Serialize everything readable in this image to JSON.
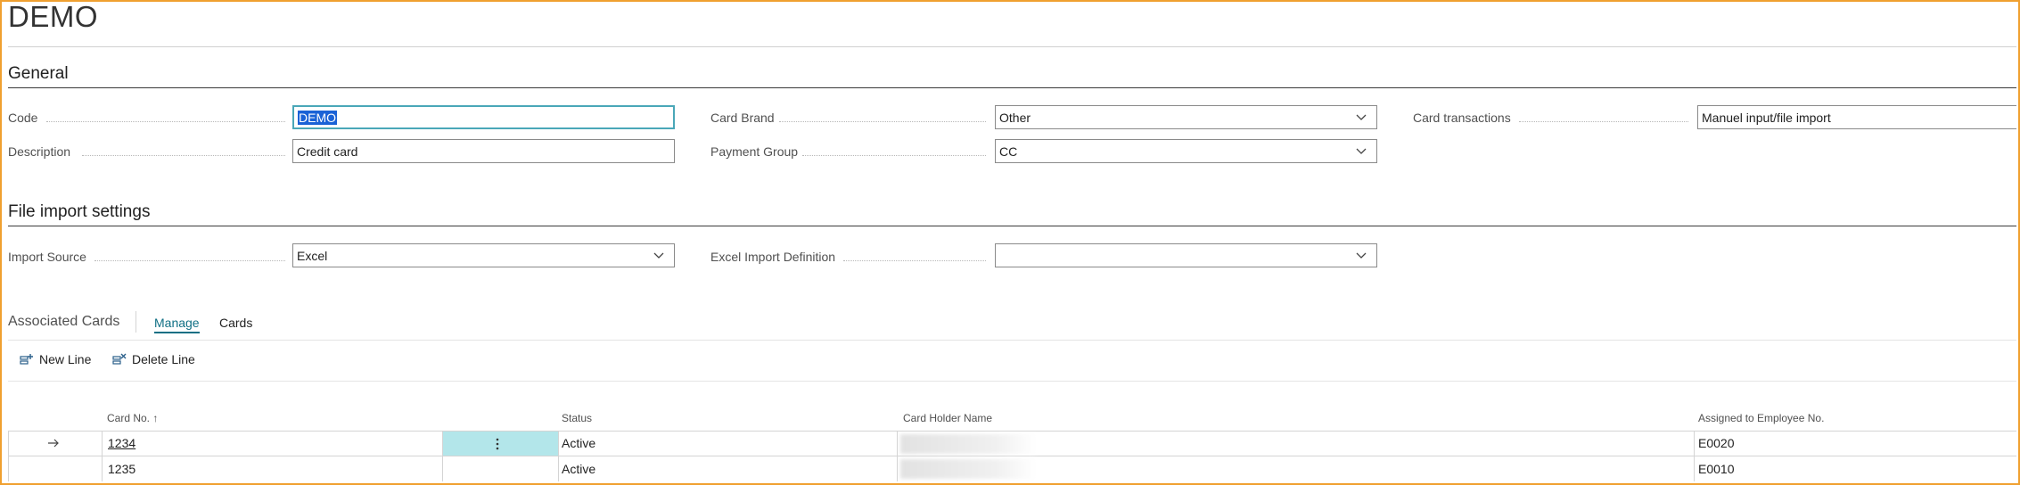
{
  "page": {
    "title": "DEMO"
  },
  "general": {
    "heading": "General",
    "code_label": "Code",
    "code_value": "DEMO",
    "description_label": "Description",
    "description_value": "Credit card",
    "card_brand_label": "Card Brand",
    "card_brand_value": "Other",
    "payment_group_label": "Payment Group",
    "payment_group_value": "CC",
    "card_transactions_label": "Card transactions",
    "card_transactions_value": "Manuel input/file import"
  },
  "file_import": {
    "heading": "File import settings",
    "import_source_label": "Import Source",
    "import_source_value": "Excel",
    "excel_def_label": "Excel Import Definition",
    "excel_def_value": ""
  },
  "associated_cards": {
    "heading": "Associated Cards",
    "tabs": [
      "Manage",
      "Cards"
    ],
    "actions": {
      "new_line": "New Line",
      "delete_line": "Delete Line"
    },
    "columns": {
      "card_no": "Card No. ↑",
      "status": "Status",
      "holder": "Card Holder Name",
      "employee": "Assigned to Employee No."
    },
    "rows": [
      {
        "card_no": "1234",
        "status": "Active",
        "employee": "E0020",
        "selected": true
      },
      {
        "card_no": "1235",
        "status": "Active",
        "employee": "E0010",
        "selected": false
      }
    ],
    "row_marker_icon": "arrow-right-icon",
    "row_menu_icon": "more-vertical-icon"
  },
  "colors": {
    "accent": "#0f6f84",
    "frame": "#f0a030",
    "selected_cell": "#b3e6ea",
    "text_selection": "#1a62d6"
  }
}
